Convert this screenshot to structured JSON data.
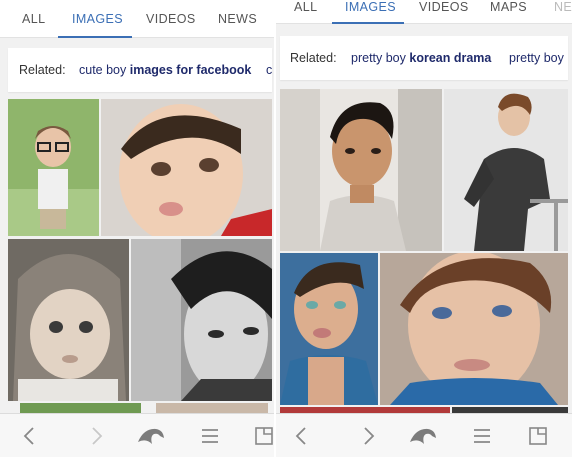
{
  "left": {
    "tabs": [
      {
        "label": "ALL"
      },
      {
        "label": "IMAGES"
      },
      {
        "label": "VIDEOS"
      },
      {
        "label": "NEWS"
      }
    ],
    "active_tab": "IMAGES",
    "related": {
      "label": "Related:",
      "link1_plain": "cute boy ",
      "link1_bold": "images for facebook",
      "link2_partial": "c"
    }
  },
  "right": {
    "tabs": [
      {
        "label": "ALL"
      },
      {
        "label": "IMAGES"
      },
      {
        "label": "VIDEOS"
      },
      {
        "label": "MAPS"
      },
      {
        "label": "NE"
      }
    ],
    "active_tab": "IMAGES",
    "related": {
      "label": "Related:",
      "link1_plain": "pretty boy ",
      "link1_bold": "korean drama",
      "link2_partial": "pretty boy"
    }
  },
  "icons": [
    "back-icon",
    "forward-icon",
    "dolphin-icon",
    "menu-icon",
    "tabs-icon"
  ],
  "colors": {
    "accent": "#3b6fb5",
    "link": "#1f2a6b",
    "background": "#f1f1f1"
  }
}
